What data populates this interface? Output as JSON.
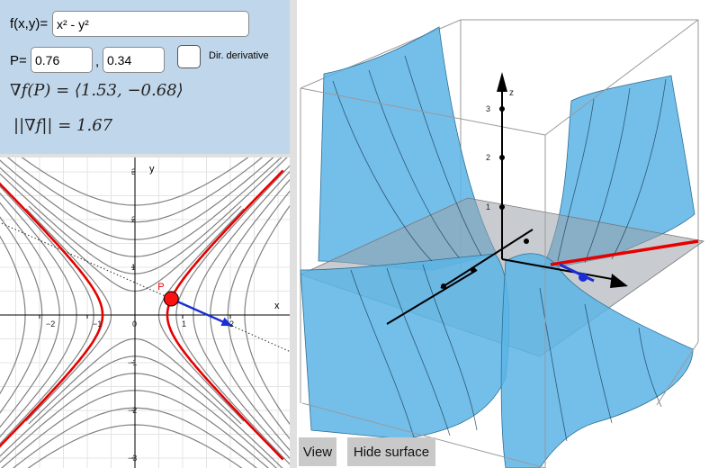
{
  "function_label": "f(x,y)=",
  "function_value": "x² - y²",
  "point_label": "P=",
  "point_x": "0.76",
  "comma": ",",
  "point_y": "0.34",
  "dir_derivative_label": "Dir. derivative",
  "gradient_text": "∇f(P) = ⟨1.53, −0.68⟩",
  "norm_text": "||∇f|| = 1.67",
  "graph2d": {
    "x_axis_label": "x",
    "y_axis_label": "y",
    "x_ticks": [
      "−2",
      "−1",
      "0",
      "1",
      "2"
    ],
    "y_ticks": [
      "3",
      "2",
      "1",
      "−1",
      "−2",
      "−3"
    ],
    "point_label": "P",
    "point": {
      "x": 0.76,
      "y": 0.34
    },
    "gradient": {
      "x": 1.53,
      "y": -0.68
    },
    "level_curve_color": "#e60000",
    "contour_color": "#808080",
    "gradient_arrow_color": "#1a2ed6"
  },
  "graph3d": {
    "z_axis_label": "z",
    "z_ticks": [
      "3",
      "2",
      "1"
    ],
    "surface_color": "#5ab4e6"
  },
  "buttons": {
    "view": "View",
    "hide_surface": "Hide surface"
  }
}
